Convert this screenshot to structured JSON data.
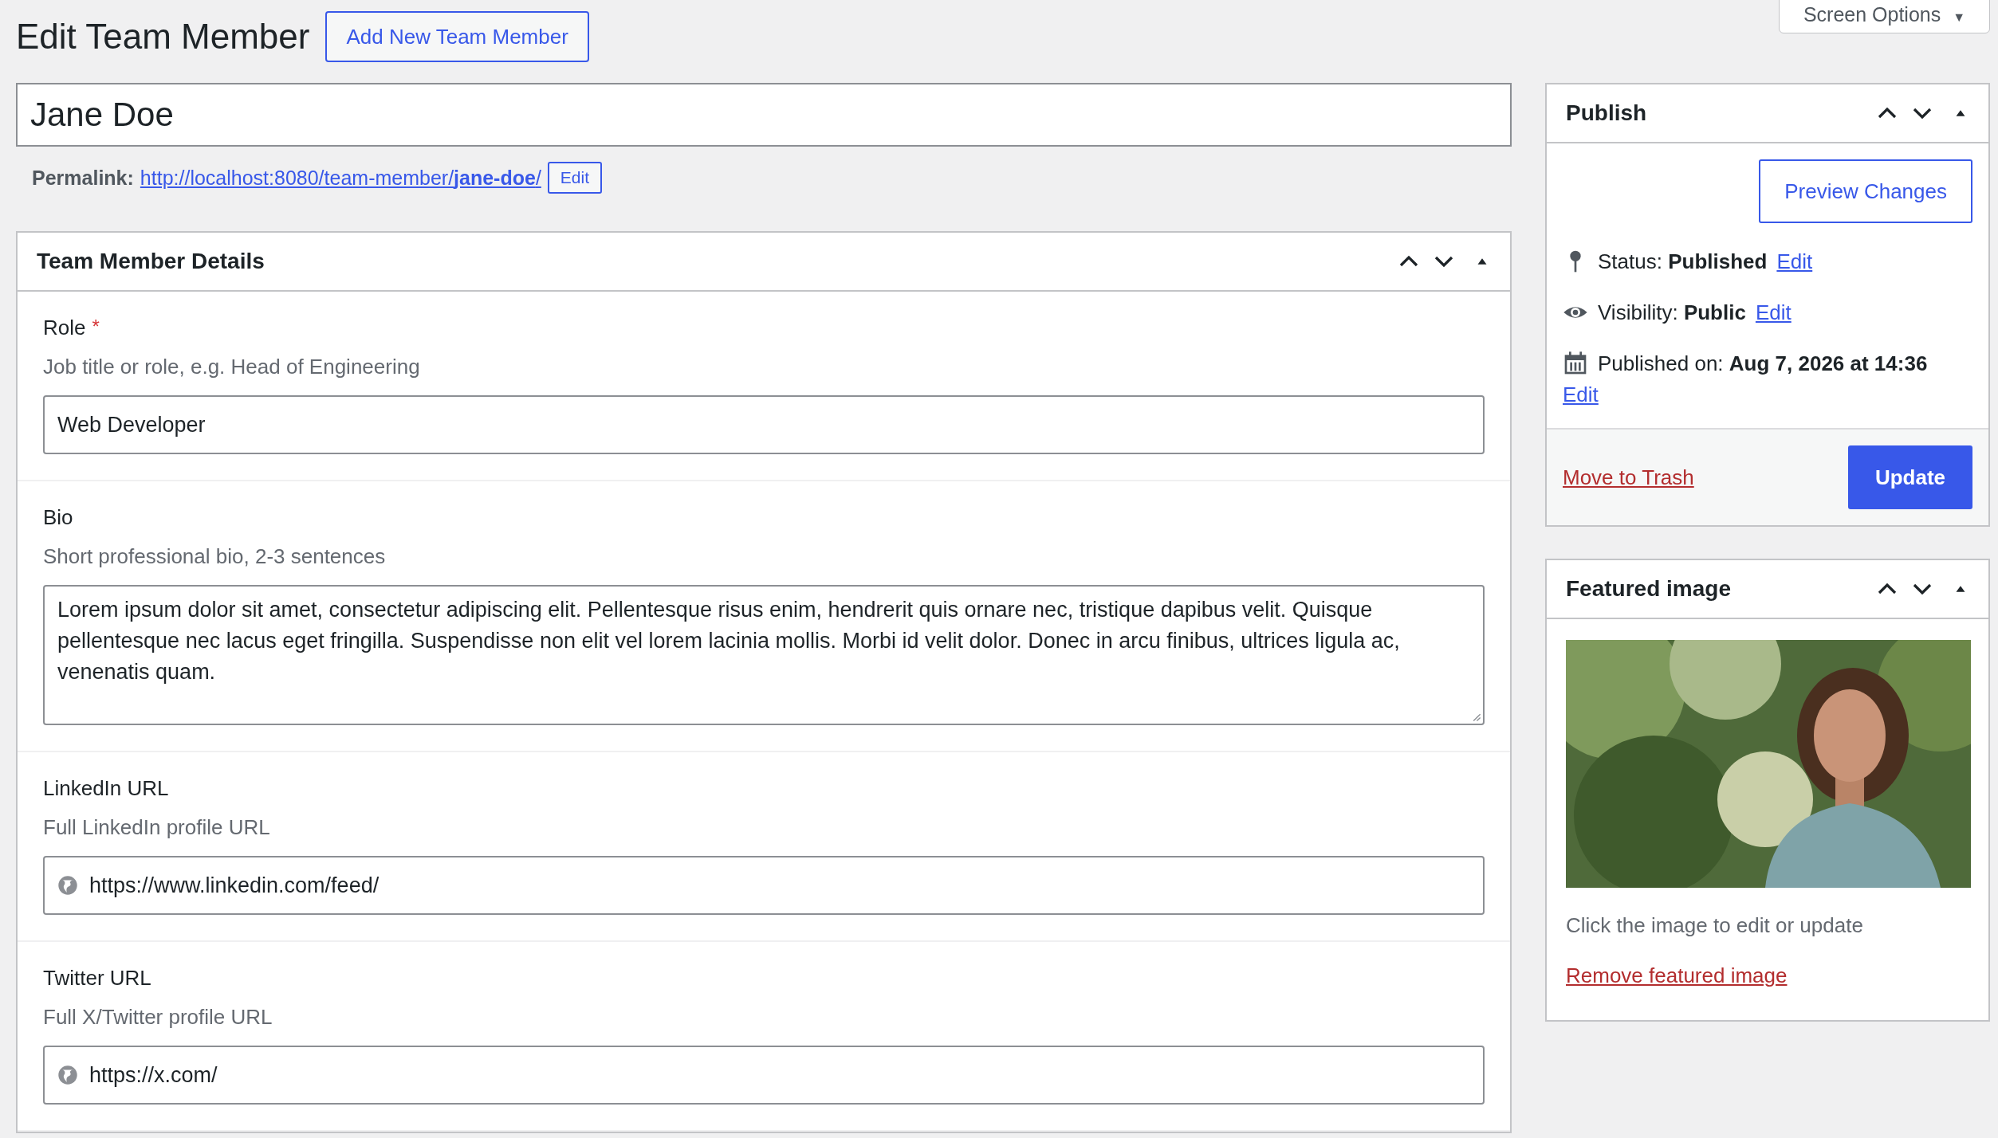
{
  "page_title": "Edit Team Member",
  "add_new_button": "Add New Team Member",
  "screen_options": {
    "label": "Screen Options",
    "caret": "▼"
  },
  "title_field": {
    "value": "Jane Doe"
  },
  "permalink": {
    "label": "Permalink:",
    "url": "http://localhost:8080/team-member/**jane-doe**/",
    "edit_button": "Edit"
  },
  "details_box": {
    "title": "Team Member Details",
    "fields": [
      {
        "kind": "text",
        "label": "Role",
        "required_mark": "*",
        "description": "Job title or role, e.g. Head of Engineering",
        "value": "Web Developer"
      },
      {
        "kind": "textarea",
        "label": "Bio",
        "description": "Short professional bio, 2-3 sentences",
        "value": "Lorem ipsum dolor sit amet, consectetur adipiscing elit. Pellentesque risus enim, hendrerit quis ornare nec, tristique dapibus velit. Quisque pellentesque nec lacus eget fringilla. Suspendisse non elit vel lorem lacinia mollis. Morbi id velit dolor. Donec in arcu finibus, ultrices ligula ac, venenatis quam."
      },
      {
        "kind": "url",
        "label": "LinkedIn URL",
        "description": "Full LinkedIn profile URL",
        "value": "https://www.linkedin.com/feed/"
      },
      {
        "kind": "url",
        "label": "Twitter URL",
        "description": "Full X/Twitter profile URL",
        "value": "https://x.com/"
      }
    ]
  },
  "publish_box": {
    "title": "Publish",
    "preview_button": "Preview Changes",
    "rows": [
      {
        "kind": "status",
        "label": "Status:",
        "value": "Published",
        "link": "Edit"
      },
      {
        "kind": "visibility",
        "label": "Visibility:",
        "value": "Public",
        "link": "Edit"
      },
      {
        "kind": "date",
        "label": "Published on:",
        "value": "Aug 7, 2026 at 14:36",
        "link": "Edit"
      }
    ],
    "trash_link": "Move to Trash",
    "update_button": "Update"
  },
  "featured_box": {
    "title": "Featured image",
    "caption": "Click the image to edit or update",
    "remove_link": "Remove featured image"
  }
}
